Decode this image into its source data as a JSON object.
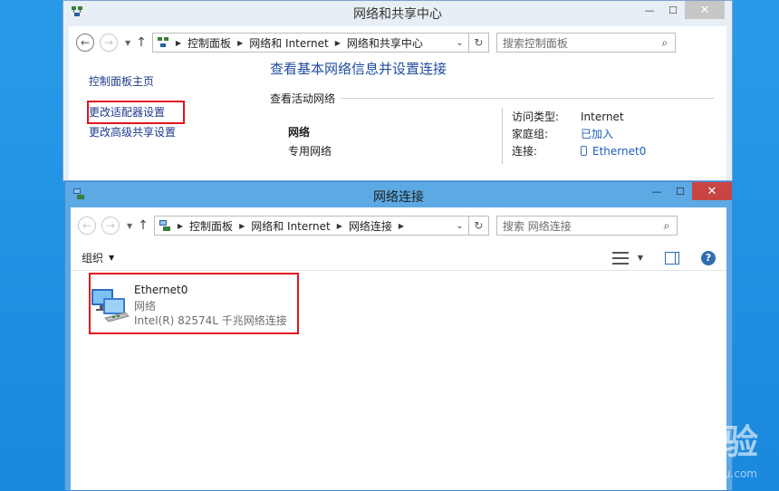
{
  "back_window": {
    "title": "网络和共享中心",
    "address": [
      "控制面板",
      "网络和 Internet",
      "网络和共享中心"
    ],
    "search_placeholder": "搜索控制面板",
    "left_nav": {
      "home": "控制面板主页",
      "adapter": "更改适配器设置",
      "advanced": "更改高级共享设置"
    },
    "main_title": "查看基本网络信息并设置连接",
    "active_networks_header": "查看活动网络",
    "network": {
      "name": "网络",
      "type": "专用网络"
    },
    "info": [
      {
        "key": "访问类型:",
        "value": "Internet"
      },
      {
        "key": "家庭组:",
        "value": "已加入"
      },
      {
        "key": "连接:",
        "value": "Ethernet0"
      }
    ]
  },
  "front_window": {
    "title": "网络连接",
    "address": [
      "控制面板",
      "网络和 Internet",
      "网络连接"
    ],
    "search_placeholder": "搜索 网络连接",
    "organize": "组织",
    "adapter": {
      "name": "Ethernet0",
      "network": "网络",
      "device": "Intel(R) 82574L 千兆网络连接"
    }
  },
  "watermark": {
    "main": "Bai du 经验",
    "sub": "jingyan.baidu.com"
  },
  "colors": {
    "highlight": "#e3141e",
    "link": "#1e5fb8",
    "title_blue": "#1e4d9c"
  }
}
